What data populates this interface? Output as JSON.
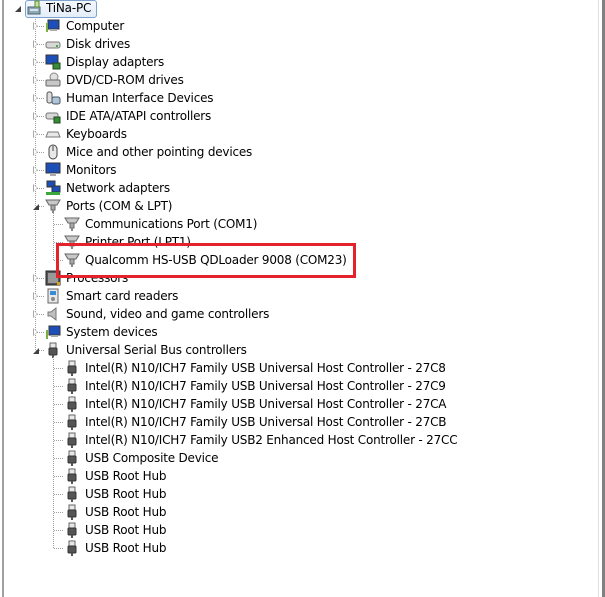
{
  "root": {
    "label": "TiNa-PC",
    "icon": "computer-tower-icon",
    "expanded": true,
    "selected": true
  },
  "categories": [
    {
      "label": "Computer",
      "icon": "computer-icon",
      "expanded": false
    },
    {
      "label": "Disk drives",
      "icon": "disk-drive-icon",
      "expanded": false
    },
    {
      "label": "Display adapters",
      "icon": "display-adapter-icon",
      "expanded": false
    },
    {
      "label": "DVD/CD-ROM drives",
      "icon": "dvd-drive-icon",
      "expanded": false
    },
    {
      "label": "Human Interface Devices",
      "icon": "hid-icon",
      "expanded": false
    },
    {
      "label": "IDE ATA/ATAPI controllers",
      "icon": "ide-controller-icon",
      "expanded": false
    },
    {
      "label": "Keyboards",
      "icon": "keyboard-icon",
      "expanded": false
    },
    {
      "label": "Mice and other pointing devices",
      "icon": "mouse-icon",
      "expanded": false
    },
    {
      "label": "Monitors",
      "icon": "monitor-icon",
      "expanded": false
    },
    {
      "label": "Network adapters",
      "icon": "network-adapter-icon",
      "expanded": false
    },
    {
      "label": "Ports (COM & LPT)",
      "icon": "port-icon",
      "expanded": true,
      "children": [
        {
          "label": "Communications Port (COM1)",
          "icon": "port-icon"
        },
        {
          "label": "Printer Port (LPT1)",
          "icon": "port-icon"
        },
        {
          "label": "Qualcomm HS-USB QDLoader 9008 (COM23)",
          "icon": "port-icon",
          "highlighted": true
        }
      ]
    },
    {
      "label": "Processors",
      "icon": "processor-icon",
      "expanded": false
    },
    {
      "label": "Smart card readers",
      "icon": "smart-card-reader-icon",
      "expanded": false
    },
    {
      "label": "Sound, video and game controllers",
      "icon": "speaker-icon",
      "expanded": false
    },
    {
      "label": "System devices",
      "icon": "system-devices-icon",
      "expanded": false
    },
    {
      "label": "Universal Serial Bus controllers",
      "icon": "usb-plug-icon",
      "expanded": true,
      "children": [
        {
          "label": "Intel(R) N10/ICH7 Family USB Universal Host Controller - 27C8",
          "icon": "usb-plug-icon"
        },
        {
          "label": "Intel(R) N10/ICH7 Family USB Universal Host Controller - 27C9",
          "icon": "usb-plug-icon"
        },
        {
          "label": "Intel(R) N10/ICH7 Family USB Universal Host Controller - 27CA",
          "icon": "usb-plug-icon"
        },
        {
          "label": "Intel(R) N10/ICH7 Family USB Universal Host Controller - 27CB",
          "icon": "usb-plug-icon"
        },
        {
          "label": "Intel(R) N10/ICH7 Family USB2 Enhanced Host Controller - 27CC",
          "icon": "usb-plug-icon"
        },
        {
          "label": "USB Composite Device",
          "icon": "usb-plug-icon"
        },
        {
          "label": "USB Root Hub",
          "icon": "usb-plug-icon"
        },
        {
          "label": "USB Root Hub",
          "icon": "usb-plug-icon"
        },
        {
          "label": "USB Root Hub",
          "icon": "usb-plug-icon"
        },
        {
          "label": "USB Root Hub",
          "icon": "usb-plug-icon"
        },
        {
          "label": "USB Root Hub",
          "icon": "usb-plug-icon"
        }
      ]
    }
  ],
  "annotation": {
    "color": "#e3222b"
  }
}
